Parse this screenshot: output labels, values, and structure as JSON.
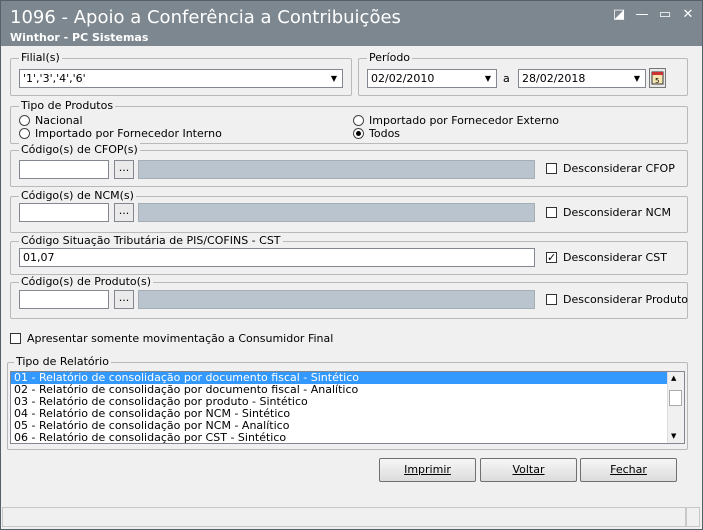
{
  "window": {
    "title": "1096 - Apoio a Conferência a Contribuições",
    "subtitle": "Winthor - PC Sistemas"
  },
  "filial": {
    "label": "Filial(s)",
    "value": "'1','3','4','6'"
  },
  "periodo": {
    "label": "Período",
    "start": "02/02/2010",
    "separator": "a",
    "end": "28/02/2018"
  },
  "tipo_produtos": {
    "label": "Tipo de Produtos",
    "options": [
      {
        "label": "Nacional",
        "selected": false
      },
      {
        "label": "Importado por Fornecedor Interno",
        "selected": false
      },
      {
        "label": "Importado por Fornecedor Externo",
        "selected": false
      },
      {
        "label": "Todos",
        "selected": true
      }
    ]
  },
  "cfop": {
    "label": "Código(s) de CFOP(s)",
    "value": "",
    "lookup": "...",
    "check_label": "Desconsiderar CFOP",
    "checked": false
  },
  "ncm": {
    "label": "Código(s) de NCM(s)",
    "value": "",
    "lookup": "...",
    "check_label": "Desconsiderar NCM",
    "checked": false
  },
  "cst": {
    "label": "Código Situação Tributária de PIS/COFINS - CST",
    "value": "01,07",
    "check_label": "Desconsiderar CST",
    "checked": true
  },
  "produto": {
    "label": "Código(s) de Produto(s)",
    "value": "",
    "lookup": "...",
    "check_label": "Desconsiderar Produto",
    "checked": false
  },
  "consumidor_final": {
    "label": "Apresentar somente movimentação a Consumidor Final",
    "checked": false
  },
  "relatorio": {
    "label": "Tipo de Relatório",
    "items": [
      "01 - Relatório de consolidação por documento fiscal - Sintético",
      "02 - Relatório de consolidação por documento fiscal - Analítico",
      "03 - Relatório de consolidação por produto - Sintético",
      "04 - Relatório de consolidação por NCM - Sintético",
      "05 - Relatório de consolidação por NCM - Analítico",
      "06 - Relatório de consolidação por CST - Sintético"
    ],
    "selected_index": 0
  },
  "buttons": {
    "print": "Imprimir",
    "back": "Voltar",
    "close": "Fechar"
  }
}
